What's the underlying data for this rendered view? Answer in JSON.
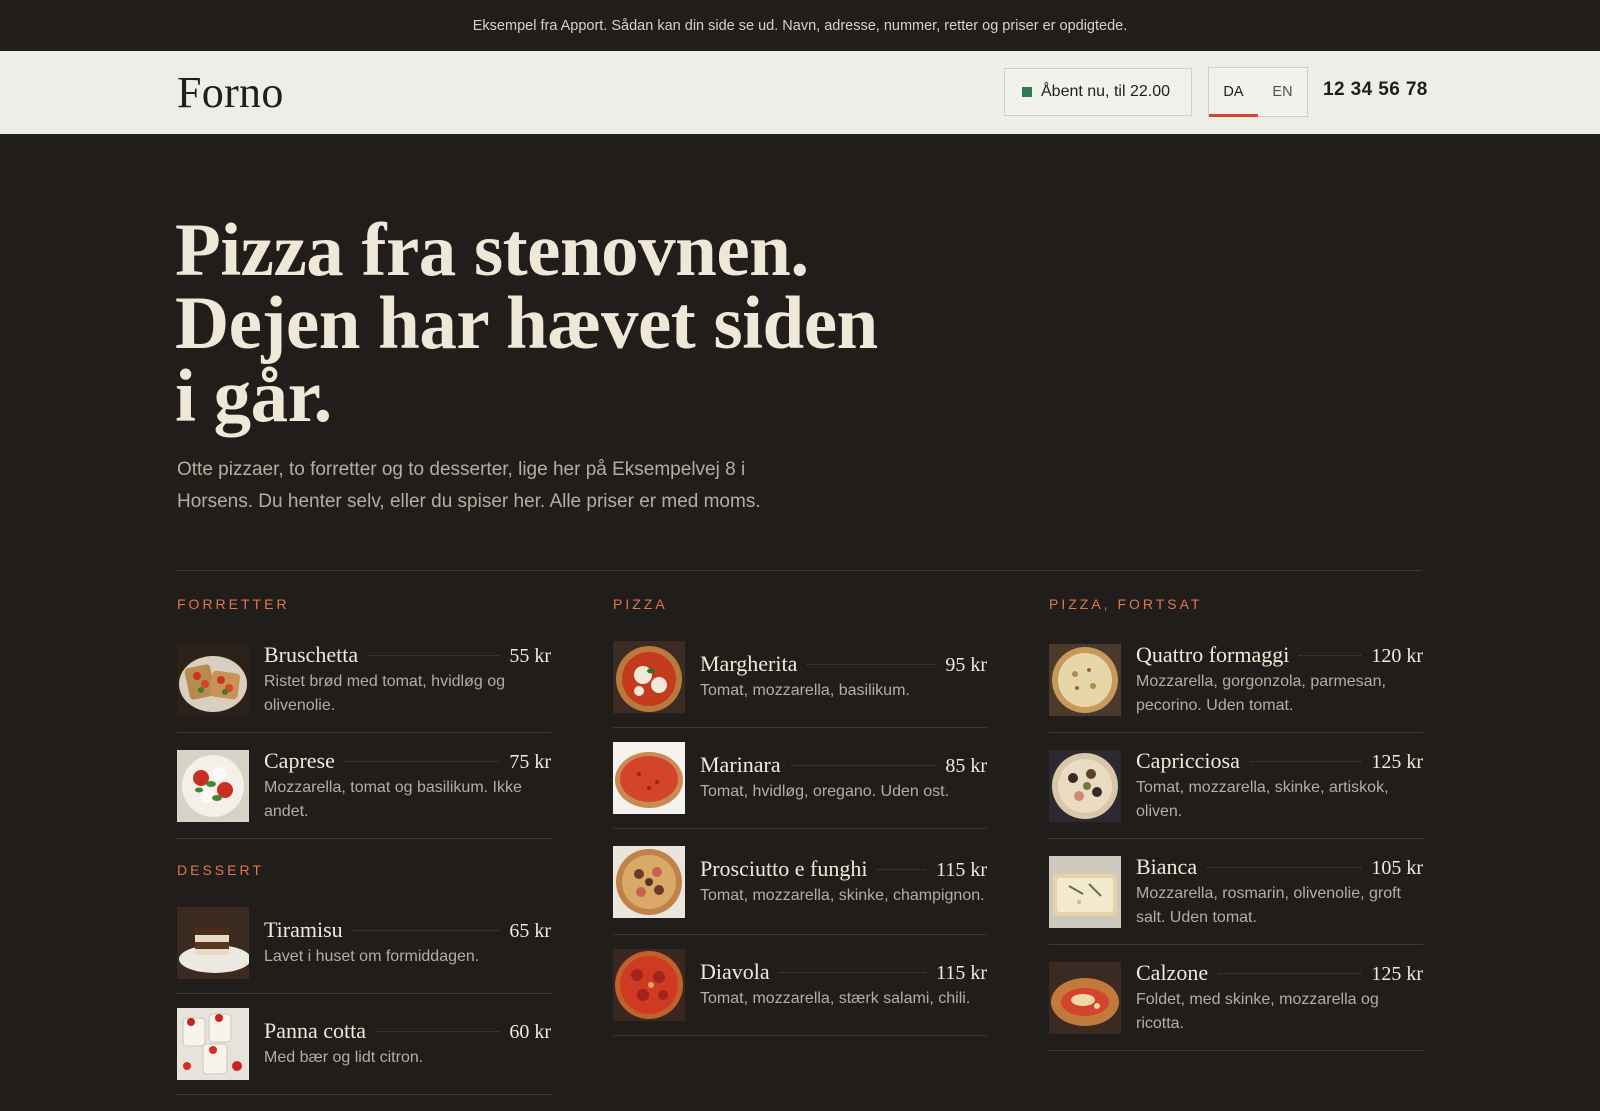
{
  "topbar": {
    "notice": "Eksempel fra Apport. Sådan kan din side se ud. Navn, adresse, nummer, retter og priser er opdigtede."
  },
  "header": {
    "logo": "Forno",
    "status": "Åbent nu, til 22.00",
    "status_color": "#2e7d52",
    "languages": [
      "DA",
      "EN"
    ],
    "active_language": "DA",
    "phone": "12 34 56 78"
  },
  "hero": {
    "title": "Pizza fra stenovnen. Dejen har hævet siden i går.",
    "subtitle": "Otte pizzaer, to forretter og to desserter, lige her på Eksempelvej 8 i Horsens. Du henter selv, eller du spiser her. Alle priser er med moms."
  },
  "accent_color": "#e0764d",
  "menu": {
    "starters": {
      "label": "FORRETTER",
      "items": [
        {
          "name": "Bruschetta",
          "price": "55 kr",
          "desc": "Ristet brød med tomat, hvidløg og olivenolie.",
          "icon": "bruschetta-photo"
        },
        {
          "name": "Caprese",
          "price": "75 kr",
          "desc": "Mozzarella, tomat og basilikum. Ikke andet.",
          "icon": "caprese-photo"
        }
      ]
    },
    "dessert": {
      "label": "DESSERT",
      "items": [
        {
          "name": "Tiramisu",
          "price": "65 kr",
          "desc": "Lavet i huset om formiddagen.",
          "icon": "tiramisu-photo"
        },
        {
          "name": "Panna cotta",
          "price": "60 kr",
          "desc": "Med bær og lidt citron.",
          "icon": "panna-cotta-photo"
        }
      ]
    },
    "pizza": {
      "label": "PIZZA",
      "items": [
        {
          "name": "Margherita",
          "price": "95 kr",
          "desc": "Tomat, mozzarella, basilikum.",
          "icon": "margherita-photo"
        },
        {
          "name": "Marinara",
          "price": "85 kr",
          "desc": "Tomat, hvidløg, oregano. Uden ost.",
          "icon": "marinara-photo"
        },
        {
          "name": "Prosciutto e funghi",
          "price": "115 kr",
          "desc": "Tomat, mozzarella, skinke, champignon.",
          "icon": "prosciutto-photo"
        },
        {
          "name": "Diavola",
          "price": "115 kr",
          "desc": "Tomat, mozzarella, stærk salami, chili.",
          "icon": "diavola-photo"
        }
      ]
    },
    "pizza_cont": {
      "label": "PIZZA, FORTSAT",
      "items": [
        {
          "name": "Quattro formaggi",
          "price": "120 kr",
          "desc": "Mozzarella, gorgonzola, parmesan, pecorino. Uden tomat.",
          "icon": "quattro-formaggi-photo"
        },
        {
          "name": "Capricciosa",
          "price": "125 kr",
          "desc": "Tomat, mozzarella, skinke, artiskok, oliven.",
          "icon": "capricciosa-photo"
        },
        {
          "name": "Bianca",
          "price": "105 kr",
          "desc": "Mozzarella, rosmarin, olivenolie, groft salt. Uden tomat.",
          "icon": "bianca-photo"
        },
        {
          "name": "Calzone",
          "price": "125 kr",
          "desc": "Foldet, med skinke, mozzarella og ricotta.",
          "icon": "calzone-photo"
        }
      ]
    }
  }
}
